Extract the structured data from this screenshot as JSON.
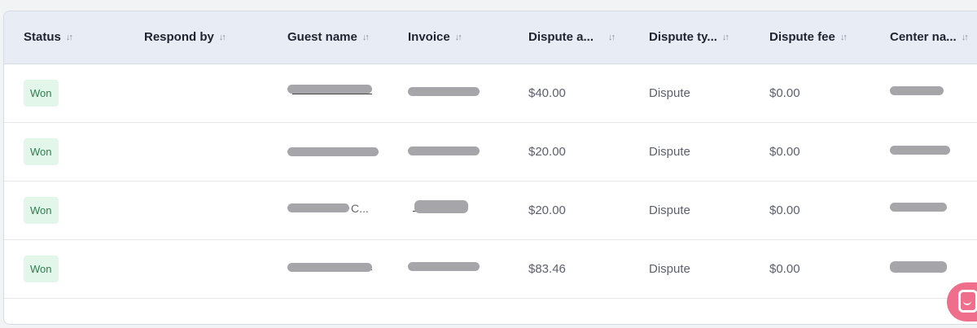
{
  "table": {
    "columns": [
      {
        "label": "Status"
      },
      {
        "label": "Respond by"
      },
      {
        "label": "Guest name"
      },
      {
        "label": "Invoice"
      },
      {
        "label": "Dispute a..."
      },
      {
        "label": "Dispute ty..."
      },
      {
        "label": "Dispute fee"
      },
      {
        "label": "Center na..."
      }
    ],
    "sort_glyph": "↓↑",
    "rows": [
      {
        "status": "Won",
        "respond_by": "",
        "dispute_amount": "$40.00",
        "dispute_type": "Dispute",
        "dispute_fee": "$0.00"
      },
      {
        "status": "Won",
        "respond_by": "",
        "dispute_amount": "$20.00",
        "dispute_type": "Dispute",
        "dispute_fee": "$0.00"
      },
      {
        "status": "Won",
        "respond_by": "",
        "dispute_amount": "$20.00",
        "dispute_type": "Dispute",
        "dispute_fee": "$0.00",
        "guest_name_fragment": "C..."
      },
      {
        "status": "Won",
        "respond_by": "",
        "dispute_amount": "$83.46",
        "dispute_type": "Dispute",
        "dispute_fee": "$0.00"
      }
    ]
  },
  "colors": {
    "header_bg": "#e8ecf5",
    "badge_bg": "#e3f6ea",
    "badge_text": "#2e7d4f",
    "launcher": "#ef6e8b",
    "redaction": "#a6a6aa"
  },
  "icons": {
    "sort": "sort-arrows-icon",
    "chat": "chat-launcher-icon"
  }
}
